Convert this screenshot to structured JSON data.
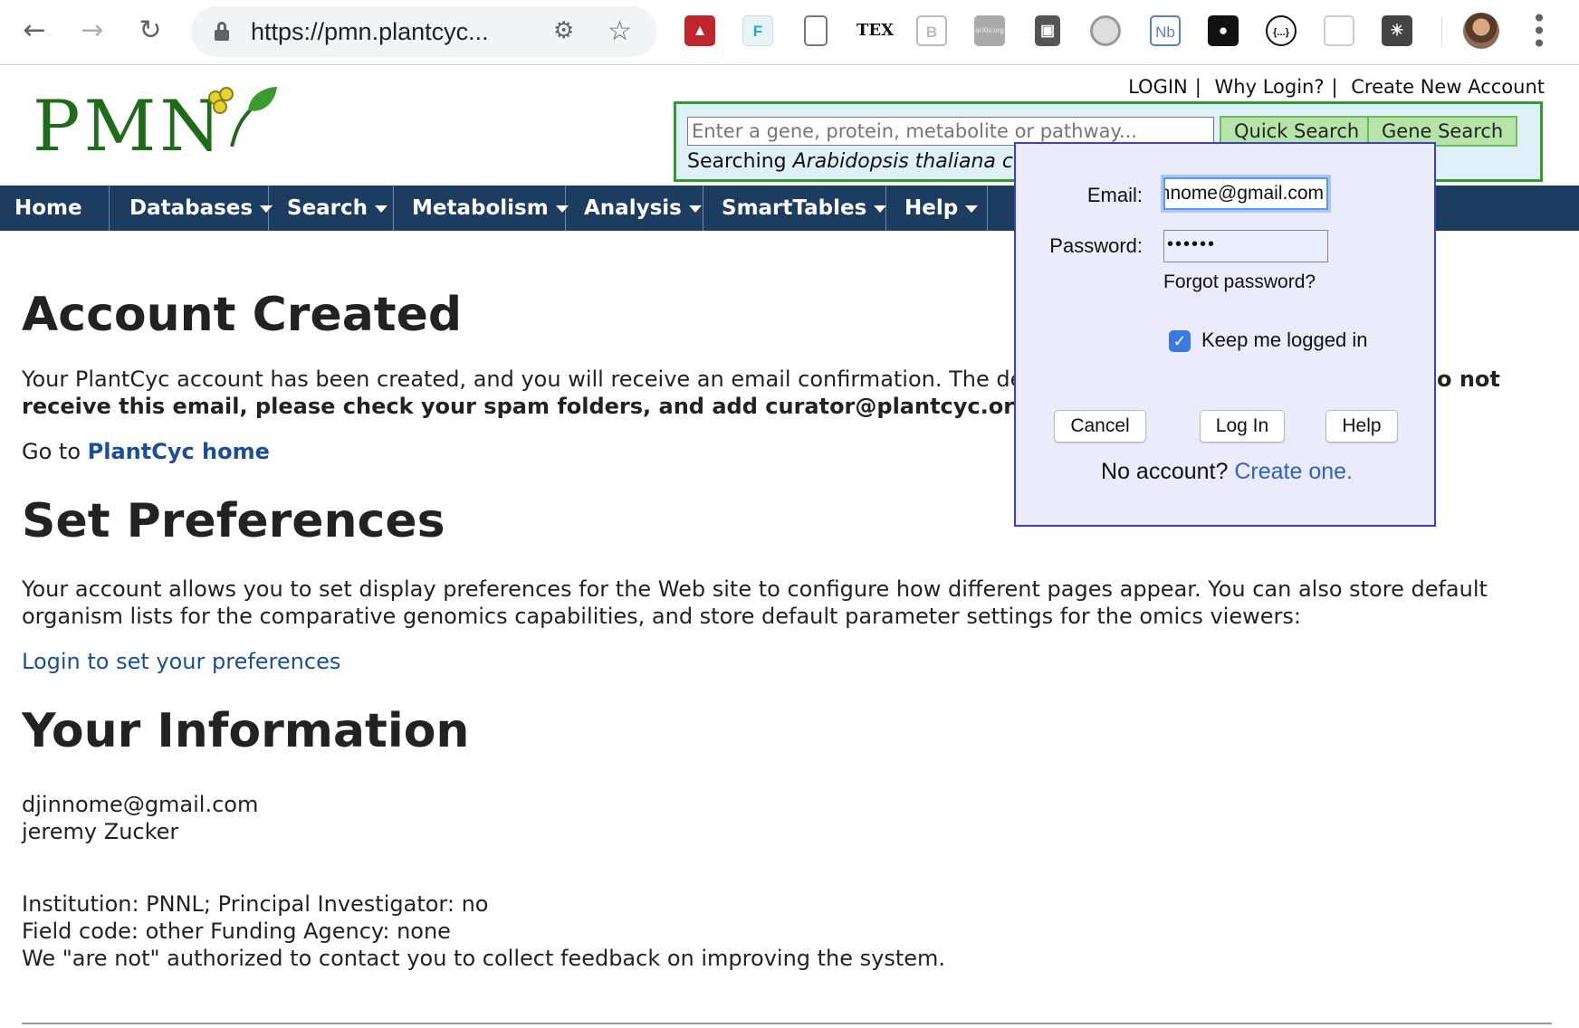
{
  "browser": {
    "url": "https://pmn.plantcyc...",
    "extensions": [
      "mendeley-icon",
      "f-extension-icon",
      "document-icon",
      "tex-icon",
      "bib-icon",
      "arxiv-icon",
      "github-icon",
      "circle-extension-icon",
      "nb-icon",
      "lock-extension-icon",
      "json-icon",
      "comment-icon",
      "lightbulb-icon"
    ],
    "ext_labels": {
      "f": "F",
      "tex": "TEX",
      "bib": "B",
      "arxiv": "arXiv.org",
      "nb": "Nb",
      "json": "{...}"
    }
  },
  "header": {
    "logo_text": "PMN",
    "links": {
      "login": "LOGIN",
      "why_login": "Why Login?",
      "create_account": "Create New Account"
    },
    "search": {
      "placeholder": "Enter a gene, protein, metabolite or pathway...",
      "quick_search": "Quick Search",
      "gene_search": "Gene Search",
      "searching_prefix": "Searching ",
      "organism": "Arabidopsis thaliana co"
    }
  },
  "nav": {
    "items": [
      {
        "label": "Home",
        "dropdown": false
      },
      {
        "label": "Databases",
        "dropdown": true
      },
      {
        "label": "Search",
        "dropdown": true
      },
      {
        "label": "Metabolism",
        "dropdown": true
      },
      {
        "label": "Analysis",
        "dropdown": true
      },
      {
        "label": "SmartTables",
        "dropdown": true
      },
      {
        "label": "Help",
        "dropdown": true
      }
    ]
  },
  "content": {
    "heading_account": "Account Created",
    "account_text_1": "Your PlantCyc account has been created, and you will receive an email confirmation. The det",
    "account_text_1_tail": "o not",
    "account_text_2": "receive this email, please check your spam folders, and add curator@plantcyc.org to your",
    "goto_prefix": "Go to ",
    "goto_link": "PlantCyc home",
    "heading_prefs": "Set Preferences",
    "prefs_text_1": "Your account allows you to set display preferences for the Web site to configure how different pages appear. You can also store default",
    "prefs_text_2": "organism lists for the comparative genomics capabilities, and store default parameter settings for the omics viewers:",
    "prefs_link": "Login to set your preferences",
    "heading_info": "Your Information",
    "email": "djinnome@gmail.com",
    "name": "jeremy Zucker",
    "institution_line": "Institution: PNNL;   Principal Investigator: no",
    "field_line": "Field code: other   Funding Agency: none",
    "contact_line": "We \"are not\" authorized to contact you to collect feedback on improving the system."
  },
  "login_popup": {
    "email_label": "Email:",
    "email_value": "djinnome@gmail.com",
    "password_label": "Password:",
    "password_value": "••••••",
    "forgot": "Forgot password?",
    "keep_logged_in": "Keep me logged in",
    "keep_checked": true,
    "cancel": "Cancel",
    "login": "Log In",
    "help": "Help",
    "no_account": "No account? ",
    "create_one": "Create one."
  },
  "colors": {
    "nav_bg": "#1c3d5f",
    "logo_green": "#1f6b1a",
    "search_border": "#2d9b2d",
    "link_blue": "#1a4e9c",
    "popup_bg": "#ecebfb",
    "popup_border": "#3b40c9"
  }
}
